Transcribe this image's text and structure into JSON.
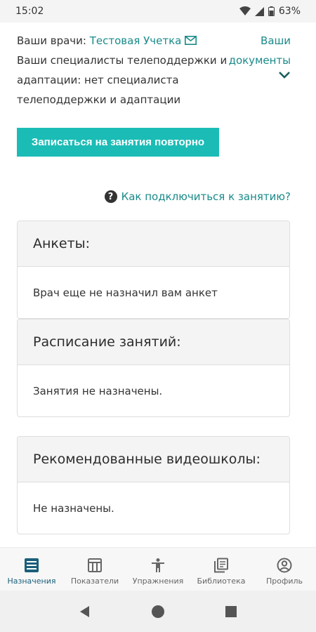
{
  "status": {
    "time": "15:02",
    "battery": "63%"
  },
  "doctors": {
    "label": "Ваши врачи:",
    "name": "Тестовая Учетка",
    "specialists": "Ваши специалисты телеподдержки и адаптации: нет специалиста телеподдержки и адаптации",
    "documents_link": "Ваши документы"
  },
  "rebook_button": "Записаться на занятия повторно",
  "help_link": "Как подключиться к занятию?",
  "cards": {
    "questionnaires": {
      "title": "Анкеты:",
      "text": "Врач еще не назначил вам анкет"
    },
    "schedule": {
      "title": "Расписание занятий:",
      "text": "Занятия не назначены."
    },
    "video": {
      "title": "Рекомендованные видеошколы:",
      "text": "Не назначены."
    }
  },
  "nav": {
    "items": [
      {
        "label": "Назначения",
        "icon": "list-icon",
        "active": true
      },
      {
        "label": "Показатели",
        "icon": "chart-icon"
      },
      {
        "label": "Упражнения",
        "icon": "person-icon"
      },
      {
        "label": "Библиотека",
        "icon": "library-icon"
      },
      {
        "label": "Профиль",
        "icon": "profile-icon"
      }
    ]
  },
  "colors": {
    "accent": "#1bbcb6",
    "link": "#1a8a8a",
    "active_nav": "#1a5f7a"
  }
}
